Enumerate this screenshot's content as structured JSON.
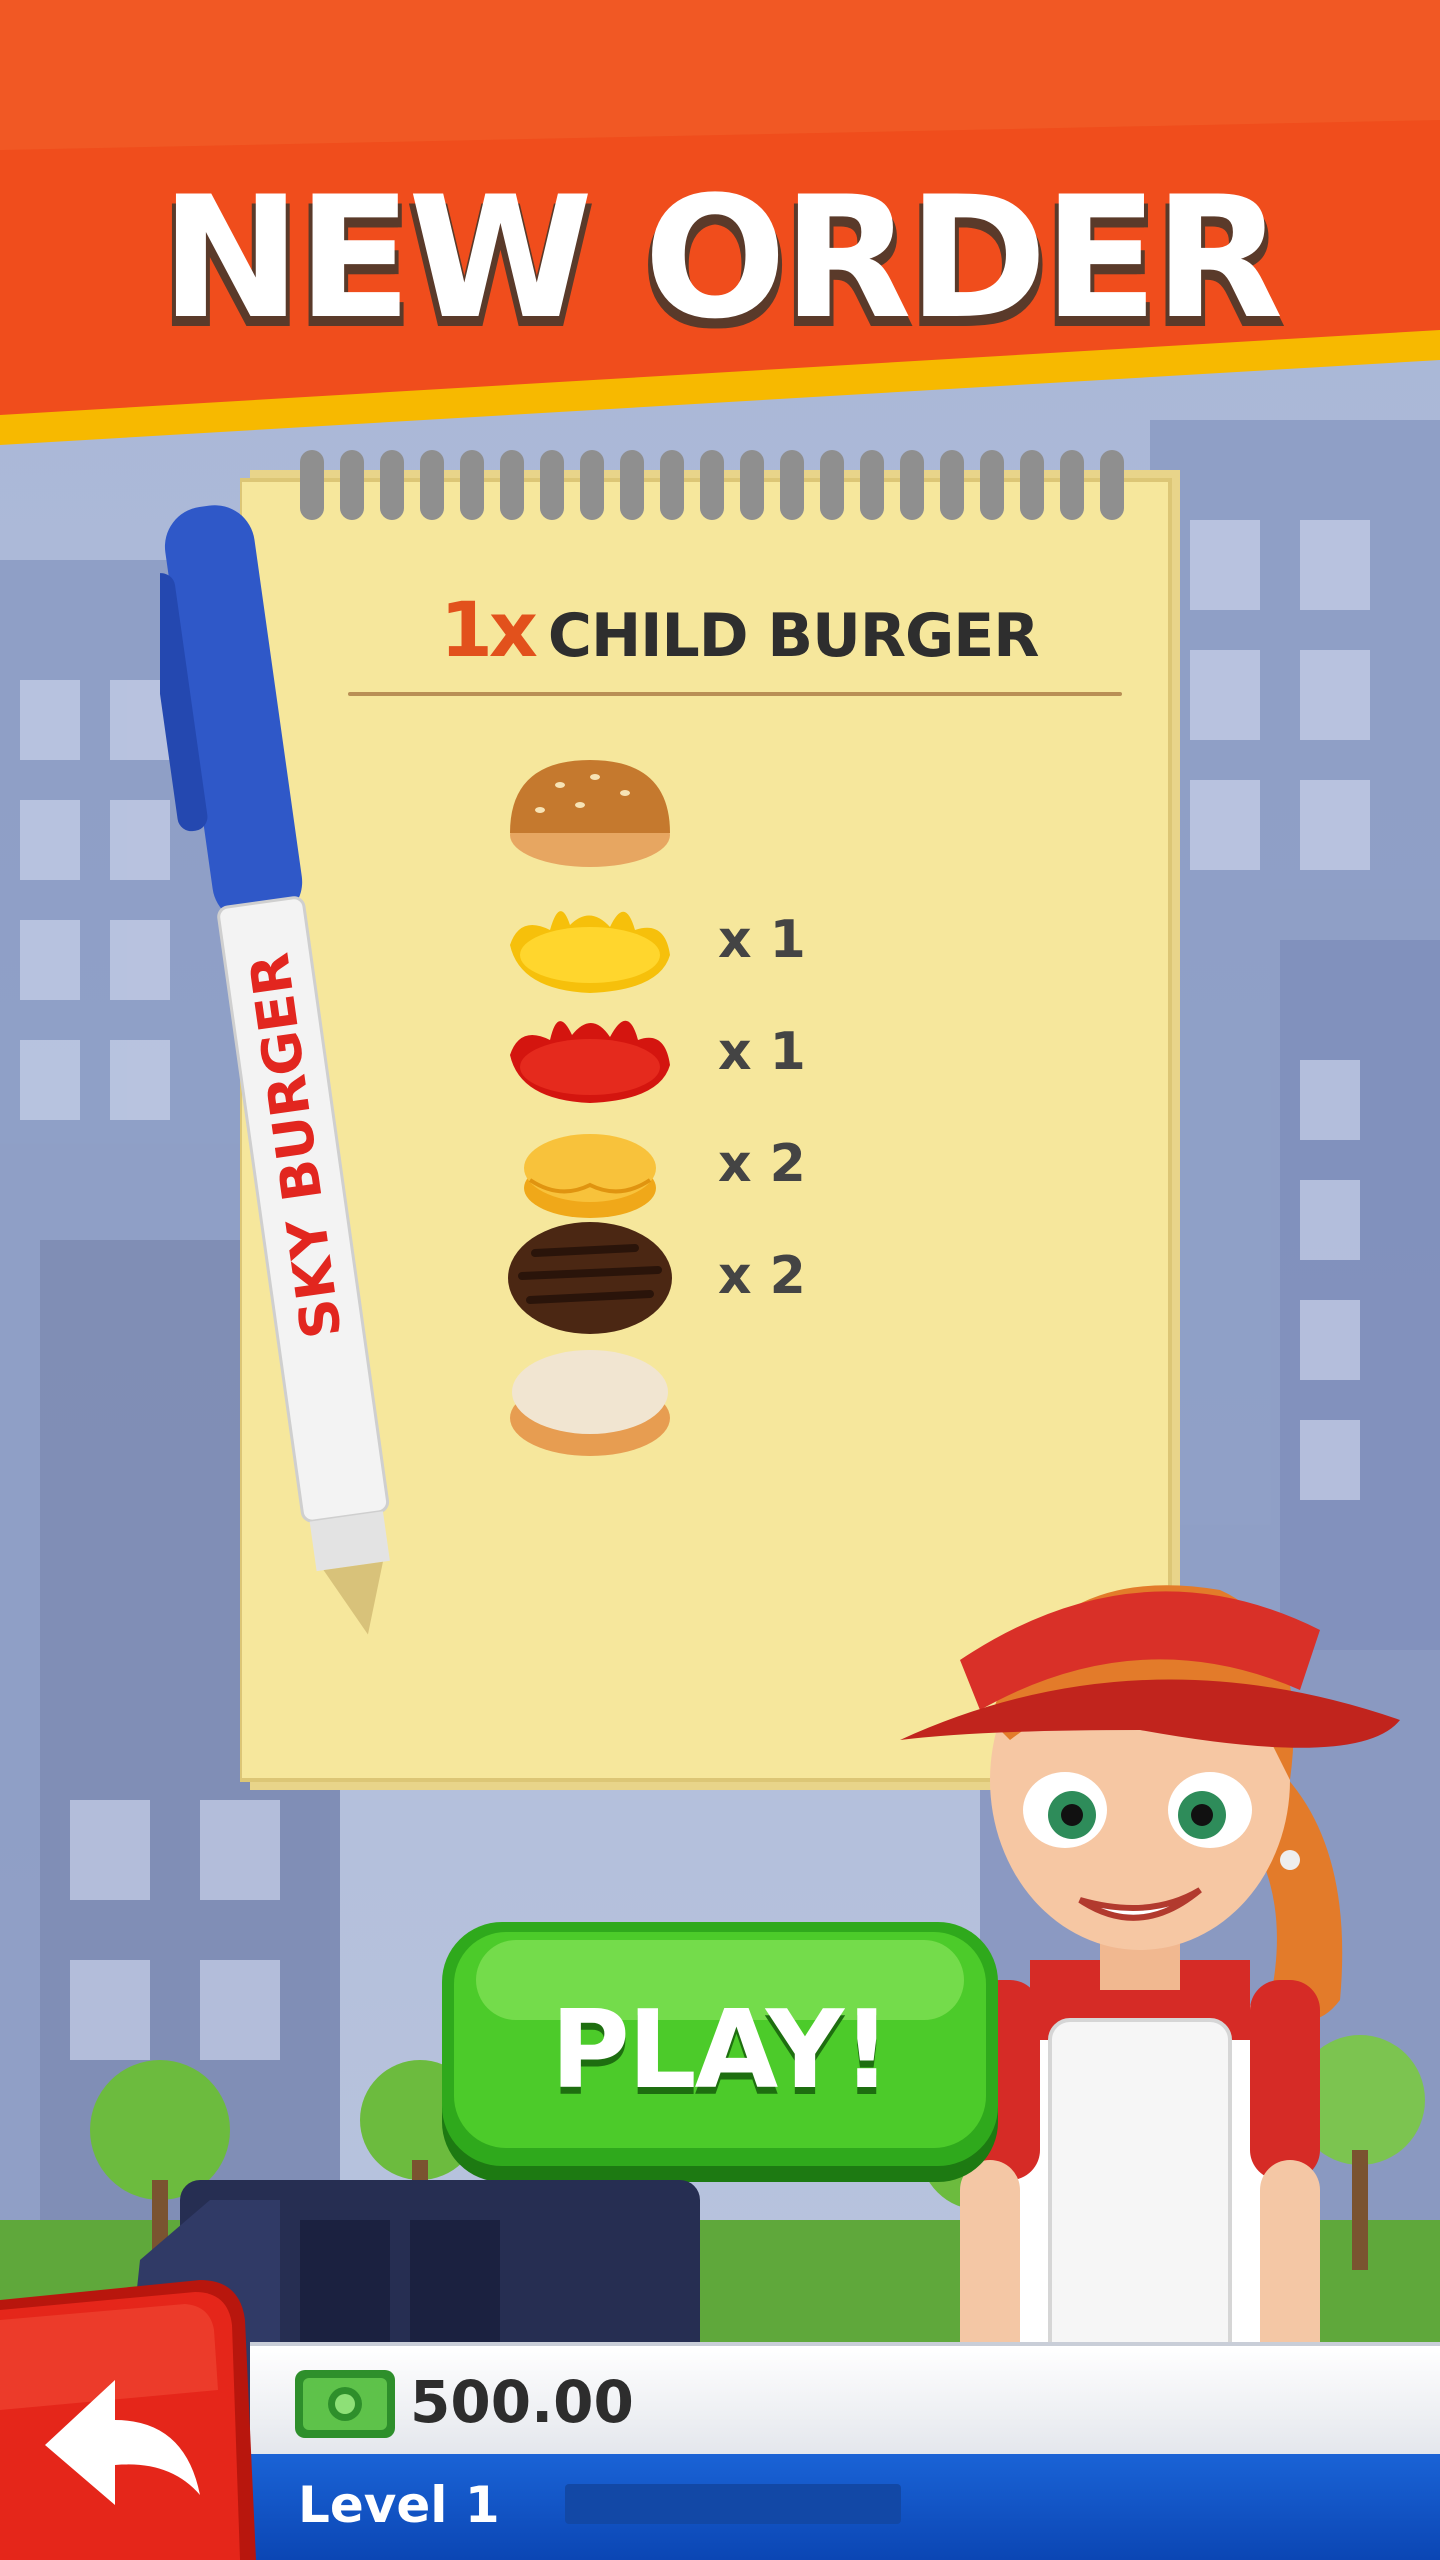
{
  "header": {
    "title": "NEW ORDER"
  },
  "order": {
    "quantity": "1x",
    "name": "CHILD BURGER",
    "ingredients": [
      {
        "name": "top-bun",
        "count": ""
      },
      {
        "name": "mustard",
        "count": "x 1"
      },
      {
        "name": "ketchup",
        "count": "x 1"
      },
      {
        "name": "cheese",
        "count": "x 2"
      },
      {
        "name": "patty",
        "count": "x 2"
      },
      {
        "name": "bottom-bun",
        "count": ""
      }
    ]
  },
  "pen": {
    "brand": "SKY BURGER"
  },
  "play_button": {
    "label": "PLAY!"
  },
  "hud": {
    "money": "500.00",
    "level_label": "Level 1",
    "level_progress": 0.0
  },
  "colors": {
    "header_orange": "#f04d1c",
    "header_stripe": "#f7b900",
    "play_green": "#3fc222",
    "hud_blue": "#0d4fc4"
  }
}
